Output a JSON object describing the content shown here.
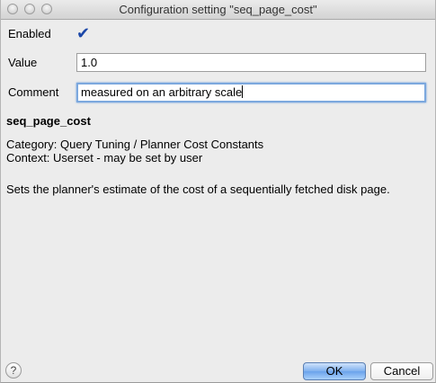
{
  "window": {
    "title": "Configuration setting \"seq_page_cost\""
  },
  "form": {
    "enabled_label": "Enabled",
    "enabled_checked": true,
    "checkmark": "✔",
    "value_label": "Value",
    "value": "1.0",
    "comment_label": "Comment",
    "comment": "measured on an arbitrary scale"
  },
  "info": {
    "name": "seq_page_cost",
    "category": "Category: Query Tuning / Planner Cost Constants",
    "context": "Context: Userset - may be set by user",
    "description": "Sets the planner's estimate of the cost of a sequentially fetched disk page."
  },
  "footer": {
    "help_glyph": "?",
    "ok_label": "OK",
    "cancel_label": "Cancel"
  }
}
